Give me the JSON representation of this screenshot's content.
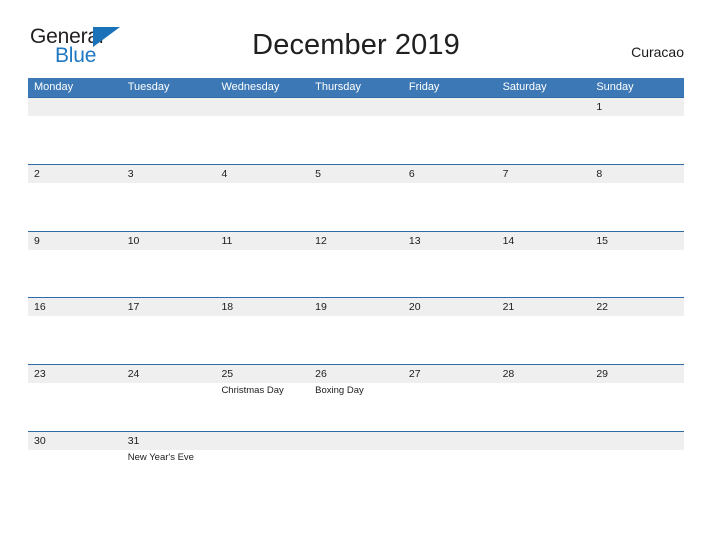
{
  "brand": {
    "word1": "General",
    "word2": "Blue",
    "flag_icon": "flag-triangle-icon",
    "color_dark": "#231f20",
    "color_blue": "#1f78c1"
  },
  "header": {
    "title": "December 2019",
    "region": "Curacao"
  },
  "theme": {
    "header_blue": "#3c78b5",
    "row_rule_blue": "#2e6ca8",
    "row_band_gray": "#efefef",
    "text": "#1c1c1c"
  },
  "calendar": {
    "month": "December",
    "year": "2019",
    "weekday_headers": [
      "Monday",
      "Tuesday",
      "Wednesday",
      "Thursday",
      "Friday",
      "Saturday",
      "Sunday"
    ],
    "weeks": [
      [
        {
          "num": "",
          "event": ""
        },
        {
          "num": "",
          "event": ""
        },
        {
          "num": "",
          "event": ""
        },
        {
          "num": "",
          "event": ""
        },
        {
          "num": "",
          "event": ""
        },
        {
          "num": "",
          "event": ""
        },
        {
          "num": "1",
          "event": ""
        }
      ],
      [
        {
          "num": "2",
          "event": ""
        },
        {
          "num": "3",
          "event": ""
        },
        {
          "num": "4",
          "event": ""
        },
        {
          "num": "5",
          "event": ""
        },
        {
          "num": "6",
          "event": ""
        },
        {
          "num": "7",
          "event": ""
        },
        {
          "num": "8",
          "event": ""
        }
      ],
      [
        {
          "num": "9",
          "event": ""
        },
        {
          "num": "10",
          "event": ""
        },
        {
          "num": "11",
          "event": ""
        },
        {
          "num": "12",
          "event": ""
        },
        {
          "num": "13",
          "event": ""
        },
        {
          "num": "14",
          "event": ""
        },
        {
          "num": "15",
          "event": ""
        }
      ],
      [
        {
          "num": "16",
          "event": ""
        },
        {
          "num": "17",
          "event": ""
        },
        {
          "num": "18",
          "event": ""
        },
        {
          "num": "19",
          "event": ""
        },
        {
          "num": "20",
          "event": ""
        },
        {
          "num": "21",
          "event": ""
        },
        {
          "num": "22",
          "event": ""
        }
      ],
      [
        {
          "num": "23",
          "event": ""
        },
        {
          "num": "24",
          "event": ""
        },
        {
          "num": "25",
          "event": "Christmas Day"
        },
        {
          "num": "26",
          "event": "Boxing Day"
        },
        {
          "num": "27",
          "event": ""
        },
        {
          "num": "28",
          "event": ""
        },
        {
          "num": "29",
          "event": ""
        }
      ],
      [
        {
          "num": "30",
          "event": ""
        },
        {
          "num": "31",
          "event": "New Year's Eve"
        },
        {
          "num": "",
          "event": ""
        },
        {
          "num": "",
          "event": ""
        },
        {
          "num": "",
          "event": ""
        },
        {
          "num": "",
          "event": ""
        },
        {
          "num": "",
          "event": ""
        }
      ]
    ],
    "holidays": [
      {
        "date": "25",
        "name": "Christmas Day"
      },
      {
        "date": "26",
        "name": "Boxing Day"
      },
      {
        "date": "31",
        "name": "New Year's Eve"
      }
    ]
  }
}
